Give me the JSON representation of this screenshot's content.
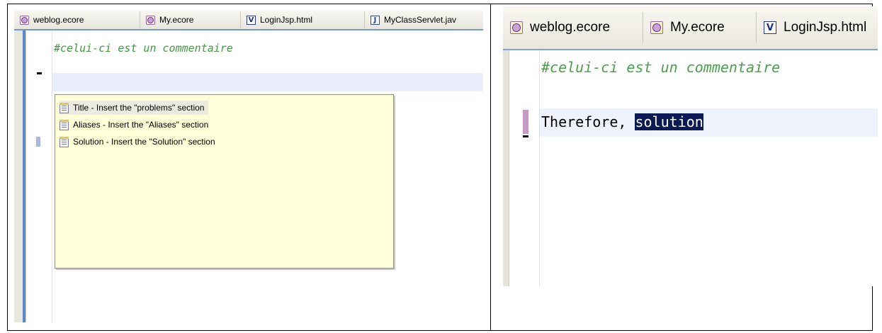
{
  "left_editor": {
    "tabs": [
      {
        "label": "weblog.ecore",
        "icon": "ecore-file-icon"
      },
      {
        "label": "My.ecore",
        "icon": "ecore-file-icon"
      },
      {
        "label": "LoginJsp.html",
        "icon": "velocity-file-icon"
      },
      {
        "label": "MyClassServlet.jav",
        "icon": "java-file-icon"
      }
    ],
    "comment_line": "#celui-ci est un commentaire",
    "proposals": [
      {
        "label": "Title - Insert the \"problems\" section",
        "icon": "template-icon",
        "selected": true
      },
      {
        "label": "Aliases - Insert the \"Aliases\" section",
        "icon": "template-icon",
        "selected": false
      },
      {
        "label": "Solution - Insert the \"Solution\" section",
        "icon": "template-icon",
        "selected": false
      }
    ]
  },
  "right_editor": {
    "tabs": [
      {
        "label": "weblog.ecore",
        "icon": "ecore-file-icon"
      },
      {
        "label": "My.ecore",
        "icon": "ecore-file-icon"
      },
      {
        "label": "LoginJsp.html",
        "icon": "velocity-file-icon"
      }
    ],
    "comment_line": "#celui-ci est un commentaire",
    "code_prefix": "Therefore, ",
    "code_selected": "solution"
  },
  "colors": {
    "comment": "#3f9a3f",
    "current_line": "#e9eefa",
    "popup_background": "#fefed8",
    "selection": "#0b1a55"
  }
}
